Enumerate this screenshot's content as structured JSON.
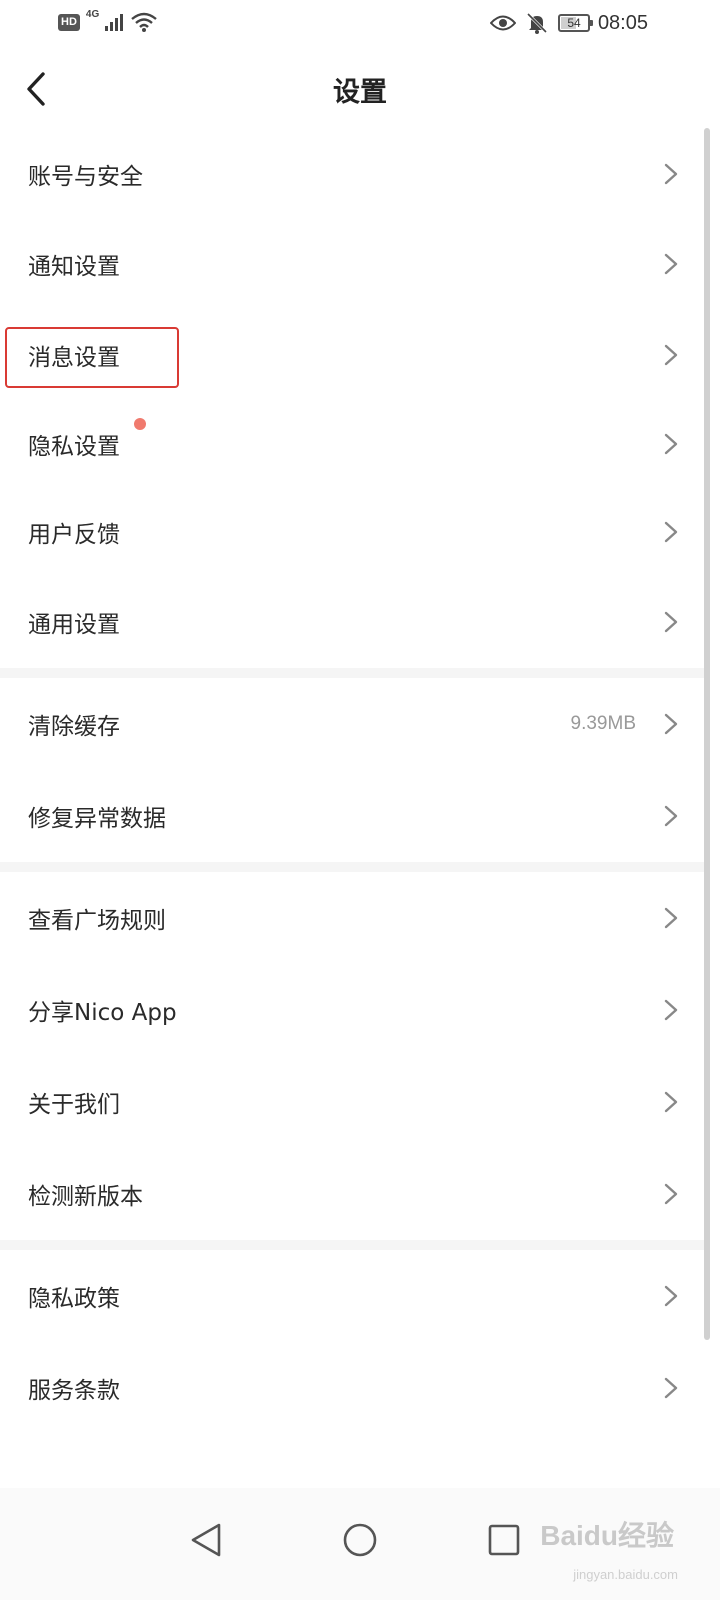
{
  "status_bar": {
    "hd": "HD",
    "network": "4G",
    "battery": "54",
    "time": "08:05"
  },
  "header": {
    "title": "设置"
  },
  "groups": [
    {
      "items": [
        {
          "label": "账号与安全"
        },
        {
          "label": "通知设置"
        },
        {
          "label": "消息设置"
        },
        {
          "label": "隐私设置"
        },
        {
          "label": "用户反馈"
        },
        {
          "label": "通用设置"
        }
      ]
    },
    {
      "items": [
        {
          "label": "清除缓存",
          "value": "9.39MB"
        },
        {
          "label": "修复异常数据"
        }
      ]
    },
    {
      "items": [
        {
          "label": "查看广场规则"
        },
        {
          "label": "分享Nico App"
        },
        {
          "label": "关于我们"
        },
        {
          "label": "检测新版本"
        }
      ]
    },
    {
      "items": [
        {
          "label": "隐私政策"
        },
        {
          "label": "服务条款"
        }
      ]
    }
  ],
  "watermark": {
    "text": "Baidu经验",
    "sub": "jingyan.baidu.com"
  },
  "icons": {
    "back": "chevron-left-icon",
    "row": "chevron-right-icon",
    "nav": [
      "back-triangle-icon",
      "home-circle-icon",
      "recents-square-icon"
    ]
  }
}
